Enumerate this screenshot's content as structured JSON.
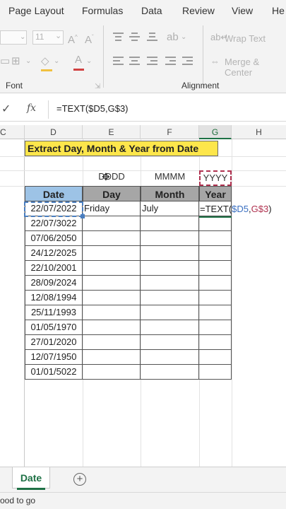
{
  "ribbon": {
    "tabs": [
      "Page Layout",
      "Formulas",
      "Data",
      "Review",
      "View",
      "He"
    ],
    "font_size": "11",
    "wrap_text_label": "Wrap Text",
    "merge_center_label": "Merge & Center",
    "font_group_label": "Font",
    "alignment_group_label": "Alignment"
  },
  "formula_bar": {
    "fx_label": "fx",
    "formula": "=TEXT($D5,G$3)"
  },
  "columns": [
    "C",
    "D",
    "E",
    "F",
    "G",
    "H"
  ],
  "sheet": {
    "title": "Extract Day, Month & Year from Date",
    "format_codes": [
      "DDDD",
      "MMMM",
      "YYYY"
    ],
    "headers": [
      "Date",
      "Day",
      "Month",
      "Year"
    ],
    "dates": [
      "22/07/2022",
      "22/07/3022",
      "07/06/2050",
      "24/12/2025",
      "22/10/2001",
      "28/09/2024",
      "12/08/1994",
      "25/11/1993",
      "01/05/1970",
      "27/01/2020",
      "12/07/1950",
      "01/01/5022"
    ],
    "first_row": {
      "day": "Friday",
      "month": "July"
    },
    "editing": {
      "prefix": "=TEXT(",
      "ref1": "$D5",
      "comma": ",",
      "ref2": "G$3",
      "suffix": ")"
    }
  },
  "sheet_tab": "Date",
  "add_sheet_symbol": "+",
  "status": "ood to go",
  "colors": {
    "title_fill": "#fde64b",
    "date_header_fill": "#9dc3e6",
    "header_fill": "#a6a6a6",
    "accent_green": "#1e7145"
  }
}
